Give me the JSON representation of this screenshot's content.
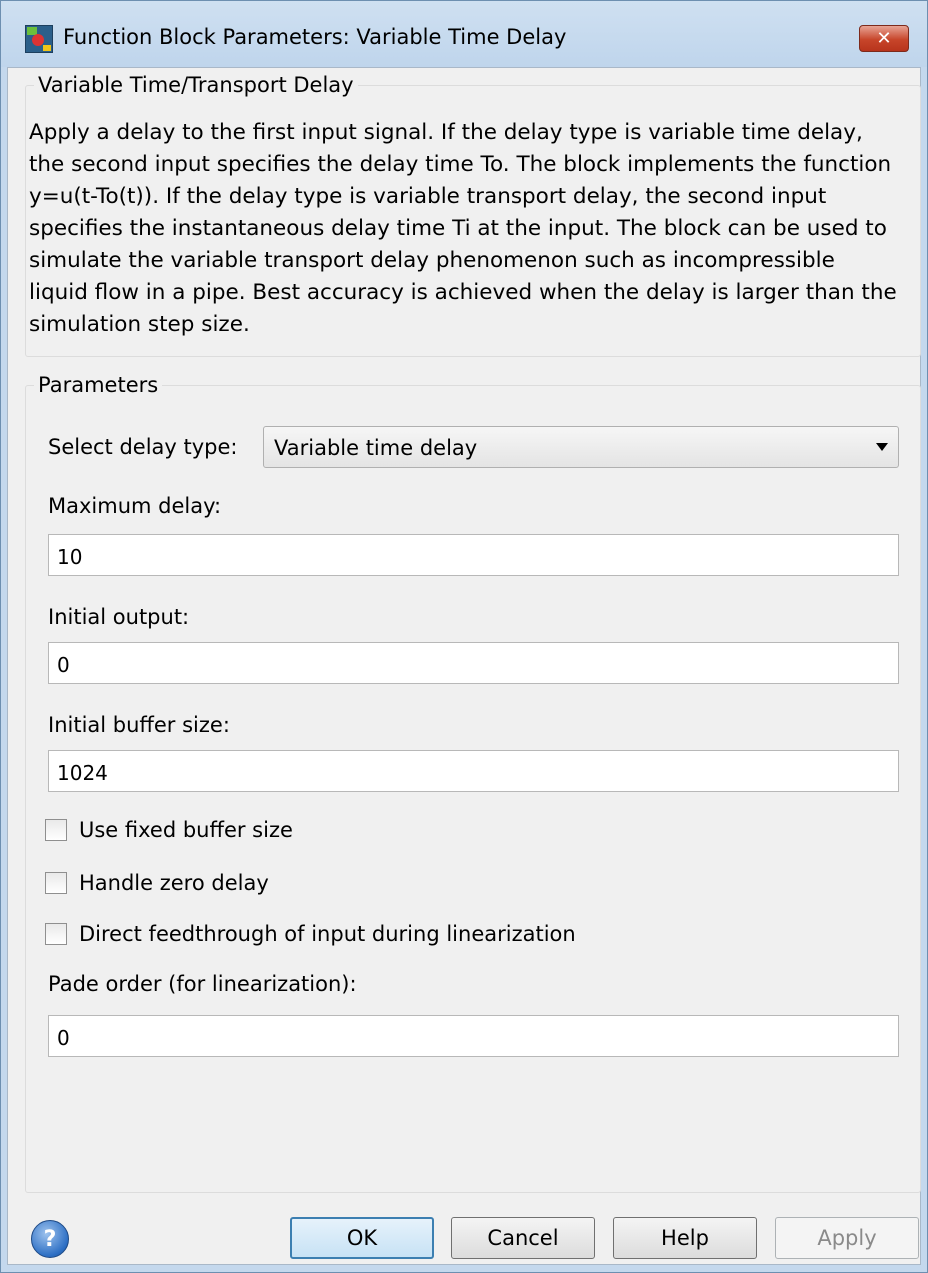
{
  "window": {
    "title": "Function Block Parameters: Variable Time Delay",
    "close_glyph": "✕"
  },
  "description_group": {
    "legend": "Variable Time/Transport Delay",
    "text": "Apply a delay to the first input signal.  If the delay type is variable time delay, the second input specifies the delay time To. The block implements the function y=u(t-To(t)). If the delay type is variable transport delay, the second input specifies the instantaneous delay time Ti at the input. The block can be used to simulate the variable transport delay phenomenon such as incompressible liquid flow in a pipe. Best accuracy is achieved when the delay is larger than the simulation step size."
  },
  "parameters": {
    "legend": "Parameters",
    "delay_type_label": "Select delay type:",
    "delay_type_value": "Variable time delay",
    "max_delay_label": "Maximum delay:",
    "max_delay_value": "10",
    "initial_output_label": "Initial output:",
    "initial_output_value": "0",
    "buffer_size_label": "Initial buffer size:",
    "buffer_size_value": "1024",
    "checkboxes": [
      {
        "label": "Use fixed buffer size",
        "checked": false
      },
      {
        "label": "Handle zero delay",
        "checked": false
      },
      {
        "label": "Direct feedthrough of input during linearization",
        "checked": false
      }
    ],
    "pade_label": "Pade order (for linearization):",
    "pade_value": "0"
  },
  "buttons": {
    "help_icon_glyph": "?",
    "ok": "OK",
    "cancel": "Cancel",
    "help": "Help",
    "apply": "Apply"
  }
}
